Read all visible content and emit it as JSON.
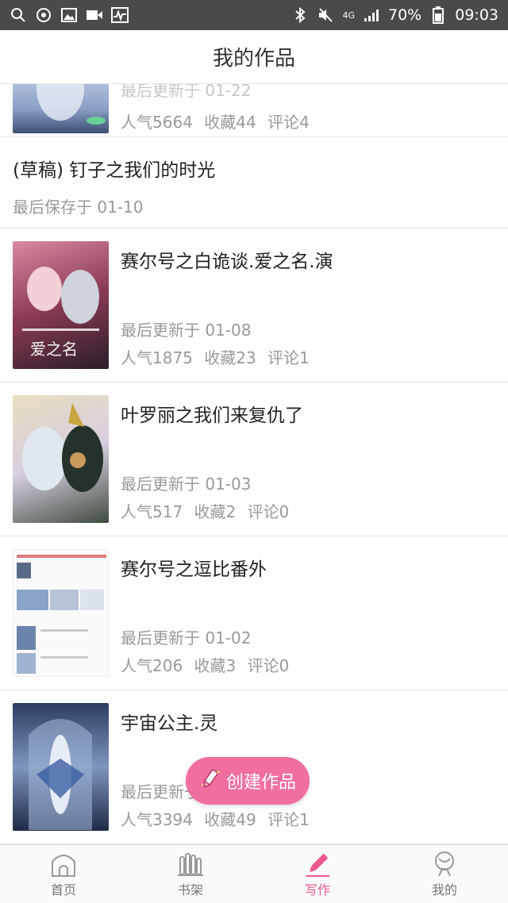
{
  "status_bar": {
    "network": "4G",
    "battery": "70%",
    "time": "09:03"
  },
  "header": {
    "title": "我的作品"
  },
  "works": [
    {
      "partial": true,
      "date_label": "最后更新于",
      "date": "01-22",
      "popularity": "人气5664",
      "favorites": "收藏44",
      "comments": "评论4"
    },
    {
      "draft": true,
      "title": "(草稿) 钉子之我们的时光",
      "date_label": "最后保存于",
      "date": "01-10"
    },
    {
      "title": "赛尔号之白诡谈.爱之名.演",
      "date_label": "最后更新于",
      "date": "01-08",
      "popularity": "人气1875",
      "favorites": "收藏23",
      "comments": "评论1",
      "cover_text": "爱之名"
    },
    {
      "title": "叶罗丽之我们来复仇了",
      "date_label": "最后更新于",
      "date": "01-03",
      "popularity": "人气517",
      "favorites": "收藏2",
      "comments": "评论0"
    },
    {
      "title": "赛尔号之逗比番外",
      "date_label": "最后更新于",
      "date": "01-02",
      "popularity": "人气206",
      "favorites": "收藏3",
      "comments": "评论0"
    },
    {
      "title": "宇宙公主.灵",
      "date_label": "最后更新于",
      "date": "",
      "popularity": "人气3394",
      "favorites": "收藏49",
      "comments": "评论1"
    }
  ],
  "fab": {
    "label": "创建作品"
  },
  "tabs": [
    {
      "label": "首页",
      "icon": "home-icon"
    },
    {
      "label": "书架",
      "icon": "bookshelf-icon"
    },
    {
      "label": "写作",
      "icon": "pen-icon",
      "active": true
    },
    {
      "label": "我的",
      "icon": "profile-icon"
    }
  ],
  "colors": {
    "accent": "#e8588e",
    "fab": "#f06fa0",
    "status_bar": "#4a4a4a"
  }
}
